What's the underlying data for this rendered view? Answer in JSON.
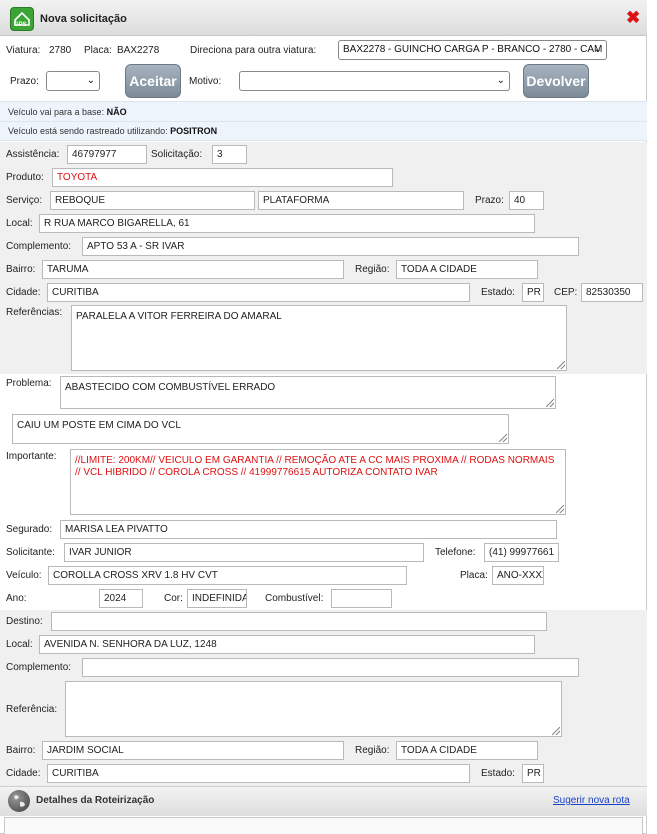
{
  "window": {
    "title": "Nova solicitação",
    "gps_badge": "GPS",
    "icon": "gps-icon",
    "close_icon": "close-icon"
  },
  "header": {
    "viatura_label": "Viatura:",
    "viatura_value": "2780",
    "placa_label": "Placa:",
    "placa_value": "BAX2278",
    "direciona_label": "Direciona para outra viatura:",
    "direciona_value": "BAX2278 - GUINCHO CARGA P - BRANCO - 2780 - CAM",
    "prazo_label": "Prazo:",
    "prazo_value": "",
    "aceitar_label": "Aceitar",
    "motivo_label": "Motivo:",
    "motivo_value": "",
    "devolver_label": "Devolver"
  },
  "info": {
    "base_label": "Veículo vai para a base:",
    "base_value": "NÃO",
    "rastreado_label": "Veículo está sendo rastreado utilizando:",
    "rastreado_value": "POSITRON"
  },
  "service": {
    "assistencia_label": "Assistência:",
    "assistencia_value": "46797977",
    "solicitacao_label": "Solicitação:",
    "solicitacao_value": "3",
    "produto_label": "Produto:",
    "produto_value": "TOYOTA",
    "servico_label": "Serviço:",
    "servico_value": "REBOQUE",
    "servico_tipo": "PLATAFORMA",
    "prazo_label": "Prazo:",
    "prazo_value": "40",
    "local_label": "Local:",
    "local_value": "R RUA MARCO BIGARELLA, 61",
    "complemento_label": "Complemento:",
    "complemento_value": "APTO 53 A - SR IVAR",
    "bairro_label": "Bairro:",
    "bairro_value": "TARUMA",
    "regiao_label": "Região:",
    "regiao_value": "TODA A CIDADE",
    "cidade_label": "Cidade:",
    "cidade_value": "CURITIBA",
    "estado_label": "Estado:",
    "estado_value": "PR",
    "cep_label": "CEP:",
    "cep_value": "82530350",
    "referencias_label": "Referências:",
    "referencias_value": "PARALELA A VITOR FERREIRA DO AMARAL"
  },
  "problem": {
    "problema_label": "Problema:",
    "problema_value": "ABASTECIDO COM COMBUSTÍVEL ERRADO",
    "observacao_value": "CAIU UM POSTE EM CIMA DO VCL",
    "importante_label": "Importante:",
    "importante_value": "//LIMITE: 200KM// VEICULO EM GARANTIA // REMOÇÃO ATE A CC MAIS PROXIMA // RODAS NORMAIS // VCL HIBRIDO // COROLA CROSS  //  41999776615 AUTORIZA CONTATO IVAR"
  },
  "customer": {
    "segurado_label": "Segurado:",
    "segurado_value": "MARISA LEA PIVATTO",
    "solicitante_label": "Solicitante:",
    "solicitante_value": "IVAR JUNIOR",
    "telefone_label": "Telefone:",
    "telefone_value": "(41) 99977661",
    "veiculo_label": "Veículo:",
    "veiculo_value": "COROLLA CROSS XRV 1.8 HV CVT",
    "placa_label": "Placa:",
    "placa_value": "ANO-XXXX",
    "ano_label": "Ano:",
    "ano_value": "2024",
    "cor_label": "Cor:",
    "cor_value": "INDEFINIDA",
    "combustivel_label": "Combustível:",
    "combustivel_value": ""
  },
  "destination": {
    "destino_label": "Destino:",
    "destino_value": "",
    "local_label": "Local:",
    "local_value": "AVENIDA N. SENHORA DA LUZ, 1248",
    "complemento_label": "Complemento:",
    "complemento_value": "",
    "referencia_label": "Referência:",
    "referencia_value": "",
    "bairro_label": "Bairro:",
    "bairro_value": "JARDIM SOCIAL",
    "regiao_label": "Região:",
    "regiao_value": "TODA A CIDADE",
    "cidade_label": "Cidade:",
    "cidade_value": "CURITIBA",
    "estado_label": "Estado:",
    "estado_value": "PR"
  },
  "footer": {
    "title": "Detalhes da Roteirização",
    "icon": "globe-icon",
    "link": "Sugerir nova rota"
  },
  "colors": {
    "red_text": "#dd1111",
    "button": "#8896a4",
    "info_bar": "#eef4fb",
    "section_gray": "#f0f0f0"
  }
}
